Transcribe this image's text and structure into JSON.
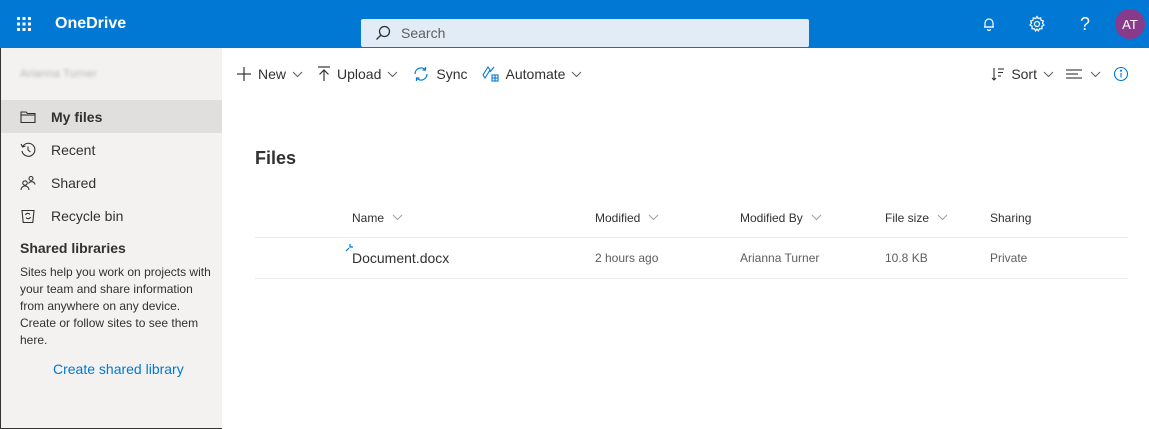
{
  "suitebar": {
    "app_name": "OneDrive",
    "search_placeholder": "Search",
    "avatar_initials": "AT",
    "help_glyph": "?",
    "color": "#0078d4"
  },
  "leftnav": {
    "username": "Arianna Turner",
    "items": [
      {
        "label": "My files",
        "icon": "folder-icon",
        "selected": true
      },
      {
        "label": "Recent",
        "icon": "recent-icon"
      },
      {
        "label": "Shared",
        "icon": "shared-icon"
      },
      {
        "label": "Recycle bin",
        "icon": "recycle-bin-icon"
      }
    ],
    "shared_libraries_title": "Shared libraries",
    "shared_libraries_desc": "Sites help you work on projects with your team and share information from anywhere on any device. Create or follow sites to see them here.",
    "create_shared_library": "Create shared library"
  },
  "cmdbar": {
    "new_label": "New",
    "upload_label": "Upload",
    "sync_label": "Sync",
    "automate_label": "Automate",
    "sort_label": "Sort"
  },
  "main": {
    "title": "Files",
    "columns": {
      "name": "Name",
      "modified": "Modified",
      "modified_by": "Modified By",
      "file_size": "File size",
      "sharing": "Sharing"
    },
    "rows": [
      {
        "name": "Document.docx",
        "modified": "2 hours ago",
        "modified_by": "Arianna Turner",
        "file_size": "10.8 KB",
        "sharing": "Private",
        "icon": "word-file-icon"
      }
    ]
  }
}
